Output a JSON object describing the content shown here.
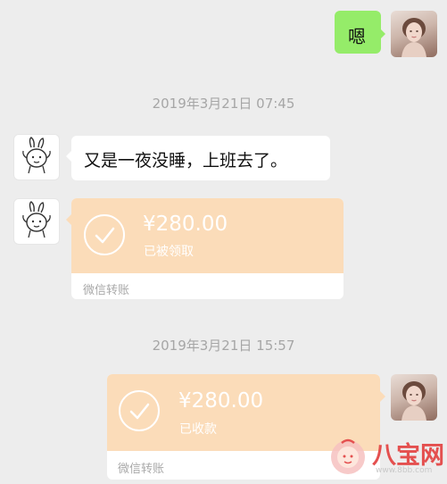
{
  "messages": {
    "reply_text": "嗯",
    "text_message": "又是一夜没睡，上班去了。",
    "received_transfer": {
      "amount": "¥280.00",
      "status": "已被领取",
      "footer": "微信转账"
    },
    "sent_transfer": {
      "amount": "¥280.00",
      "status": "已收款",
      "footer": "微信转账"
    }
  },
  "timestamps": {
    "first": "2019年3月21日 07:45",
    "second": "2019年3月21日 15:57"
  },
  "watermark": {
    "name": "八宝网",
    "url": "www.8bb.com"
  },
  "colors": {
    "chat_background": "#ededed",
    "green_bubble": "#95ec69",
    "transfer_accent": "#fbdcb9",
    "watermark_red": "#e4504f"
  },
  "icons": {
    "my_avatar": "portrait-avatar",
    "friend_avatar": "rabbit-doodle-icon",
    "transfer_status": "checkmark-circle-icon"
  }
}
